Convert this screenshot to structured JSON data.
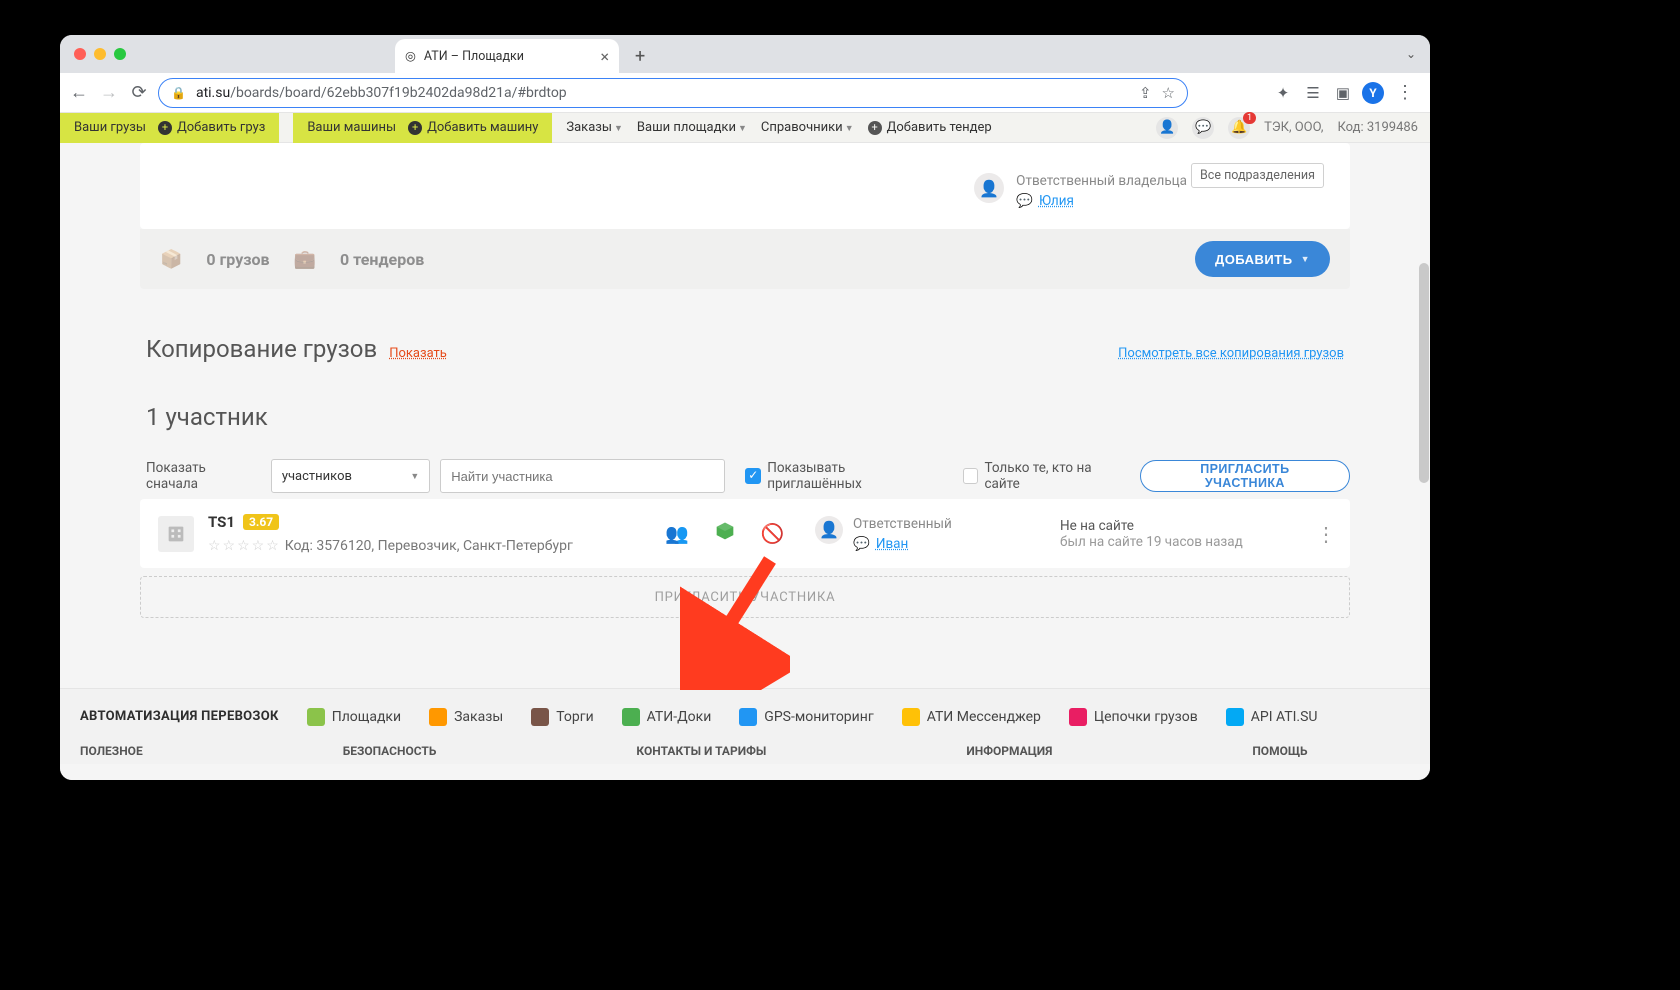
{
  "browser": {
    "tab_title": "АТИ – Площадки",
    "url_host": "ati.su",
    "url_path": "/boards/board/62ebb307f19b2402da98d21a/#brdtop",
    "avatar_initial": "Y"
  },
  "appnav": {
    "your_cargo": "Ваши грузы",
    "add_cargo": "Добавить груз",
    "your_vehicles": "Ваши машины",
    "add_vehicle": "Добавить машину",
    "orders": "Заказы",
    "your_boards": "Ваши площадки",
    "refs": "Справочники",
    "add_tender": "Добавить тендер",
    "company": "ТЭК, ООО,",
    "code_label": "Код:",
    "code_value": "3199486"
  },
  "top_card": {
    "dept_tag": "Все подразделения",
    "owner_label": "Ответственный владельца",
    "owner_name": "Юлия",
    "cargo_count": "0 грузов",
    "tender_count": "0 тендеров",
    "add_btn": "ДОБАВИТЬ"
  },
  "copy_section": {
    "title": "Копирование грузов",
    "show_link": "Показать",
    "view_all_link": "Посмотреть все копирования грузов"
  },
  "participants": {
    "heading": "1 участник",
    "show_first_label": "Показать сначала",
    "sort_value": "участников",
    "search_placeholder": "Найти участника",
    "chk_invited": "Показывать приглашённых",
    "chk_online": "Только те, кто на сайте",
    "invite_btn": "ПРИГЛАСИТЬ УЧАСТНИКА",
    "row": {
      "name": "TS1",
      "score": "3.67",
      "meta": "Код: 3576120, Перевозчик, Санкт-Петербург",
      "resp_label": "Ответственный",
      "resp_name": "Иван",
      "status": "Не на сайте",
      "last_seen": "был на сайте 19 часов назад"
    },
    "invite_box": "ПРИГЛАСИТЬ УЧАСТНИКА"
  },
  "footer": {
    "heading": "АВТОМАТИЗАЦИЯ ПЕРЕВОЗОК",
    "items": [
      "Площадки",
      "Заказы",
      "Торги",
      "АТИ-Доки",
      "GPS-мониторинг",
      "АТИ Мессенджер",
      "Цепочки грузов",
      "API ATI.SU"
    ],
    "cats": [
      "ПОЛЕЗНОЕ",
      "БЕЗОПАСНОСТЬ",
      "КОНТАКТЫ И ТАРИФЫ",
      "ИНФОРМАЦИЯ",
      "ПОМОЩЬ"
    ]
  }
}
